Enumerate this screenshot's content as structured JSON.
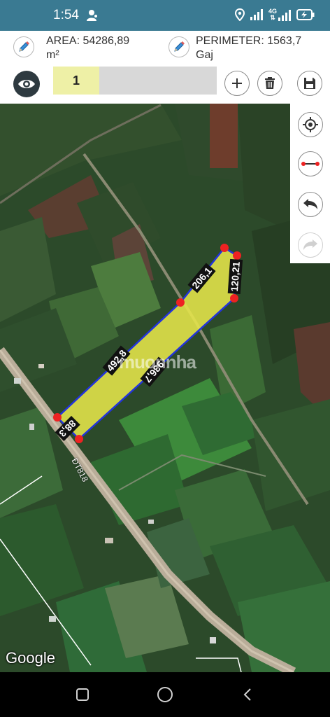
{
  "status_bar": {
    "time": "1:54",
    "network_type": "4G",
    "icons": [
      "person-icon",
      "location-icon",
      "signal-icon",
      "4g-signal-icon",
      "battery-charging-icon"
    ]
  },
  "toolbar": {
    "area_label": "AREA: 54286,89",
    "area_unit": "m²",
    "perimeter_label": "PERIMETER: 1563,7",
    "perimeter_unit": "Gaj",
    "layer_name": "1",
    "icons": [
      "pencil-icon",
      "eye-icon",
      "plus-icon",
      "trash-icon",
      "save-icon"
    ]
  },
  "map": {
    "polygon_color": "#e6e64a",
    "outline_color": "#2233dd",
    "vertex_color": "#ee2222",
    "edge_labels": {
      "top_left": "206,1",
      "top_right": "120,21",
      "long_top": "492,8",
      "long_bottom": "936,7",
      "bottom": "88,3"
    },
    "road_label": "ĐT818",
    "watermark": "muonnha",
    "attribution": "Google"
  },
  "side_panel": {
    "icons": [
      "my-location-icon",
      "measure-line-icon",
      "undo-icon",
      "redo-icon"
    ]
  },
  "nav_bar": {
    "icons": [
      "recent-apps-icon",
      "home-icon",
      "back-icon"
    ]
  }
}
